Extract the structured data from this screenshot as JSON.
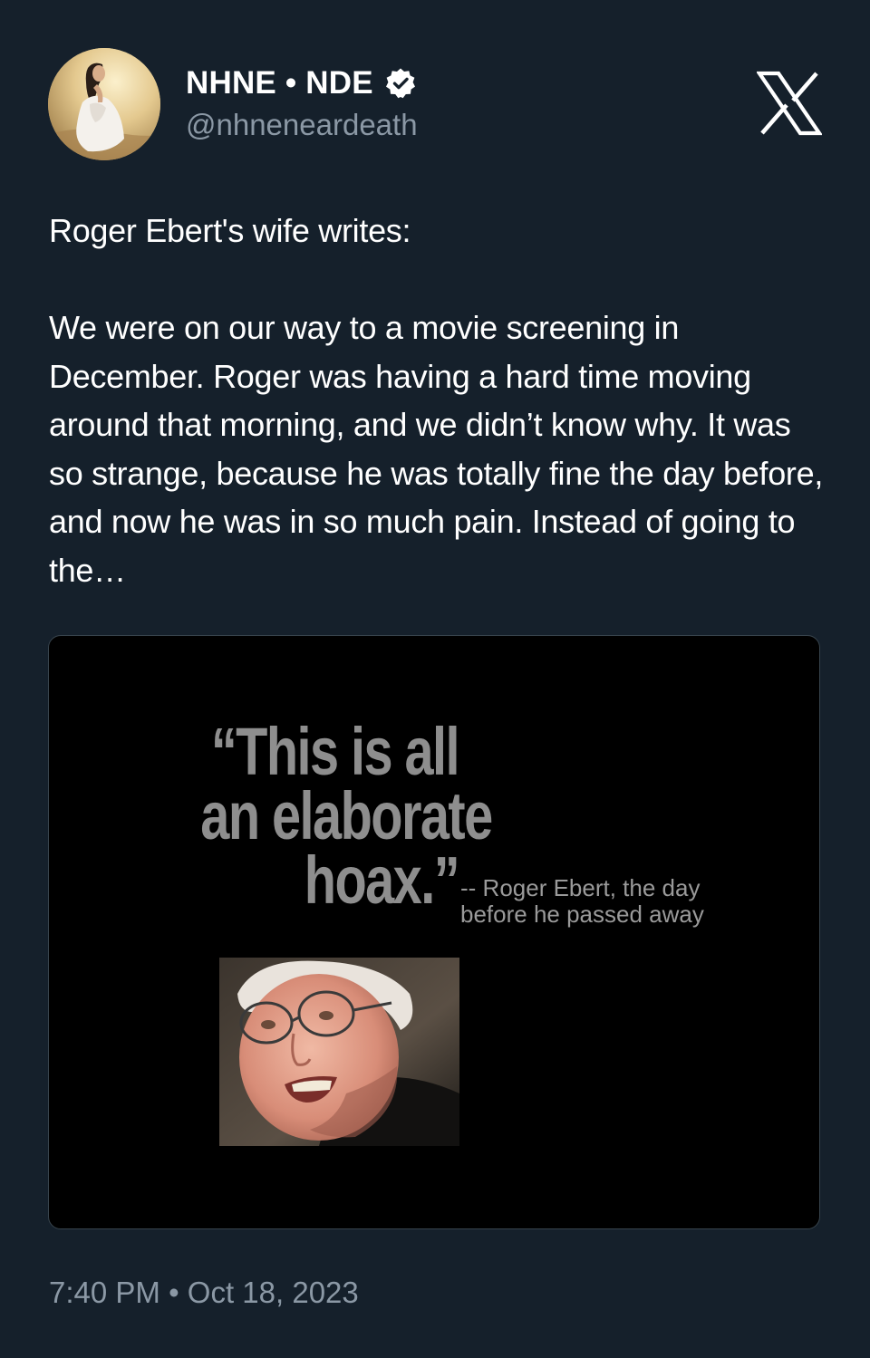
{
  "author": {
    "display_name": "NHNE • NDE",
    "handle": "@nhneneardeath",
    "verified": true,
    "avatar_icon": "avatar-woman-in-white-dress"
  },
  "platform_logo": "x-logo",
  "tweet": {
    "text": "Roger Ebert's wife writes:\n\nWe were on our way to a movie screening in December. Roger was having a hard time moving around that morning, and we didn’t know why. It was so strange, because he was totally fine the day before, and now he was in so much pain. Instead of going to the…"
  },
  "media": {
    "quote": "“This is all\nan elaborate\nhoax.”",
    "attribution": "-- Roger Ebert, the day\nbefore he passed away"
  },
  "footer": {
    "timestamp": "7:40 PM • Oct 18, 2023"
  },
  "colors": {
    "background": "#15202b",
    "secondary_text": "#8b98a5",
    "verified": "#ffffff"
  }
}
